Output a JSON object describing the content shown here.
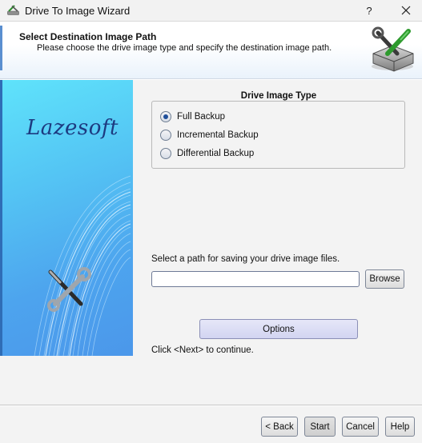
{
  "window": {
    "title": "Drive To Image Wizard",
    "help_glyph": "?",
    "icons": {
      "app": "lazesoft-tools-icon",
      "close": "close-icon"
    }
  },
  "header": {
    "title": "Select Destination Image Path",
    "subtitle": "Please choose the drive image type and specify the destination image path.",
    "icon": "drive-tools-icon"
  },
  "banner": {
    "brand": "Lazesoft",
    "icon": "wrench-screwdriver-icon",
    "colors": {
      "top": "#5fe3fb",
      "bottom": "#4b97ea",
      "brand_text": "#1d3a80"
    }
  },
  "drive_image_type": {
    "title": "Drive Image Type",
    "options": [
      {
        "label": "Full Backup",
        "checked": true
      },
      {
        "label": "Incremental Backup",
        "checked": false
      },
      {
        "label": "Differential Backup",
        "checked": false
      }
    ]
  },
  "path": {
    "label": "Select a path for saving your drive image files.",
    "value": "",
    "browse_label": "Browse"
  },
  "options_label": "Options",
  "continue_text": "Click <Next> to continue.",
  "footer": {
    "back_label": "< Back",
    "start_label": "Start",
    "cancel_label": "Cancel",
    "help_label": "Help"
  }
}
